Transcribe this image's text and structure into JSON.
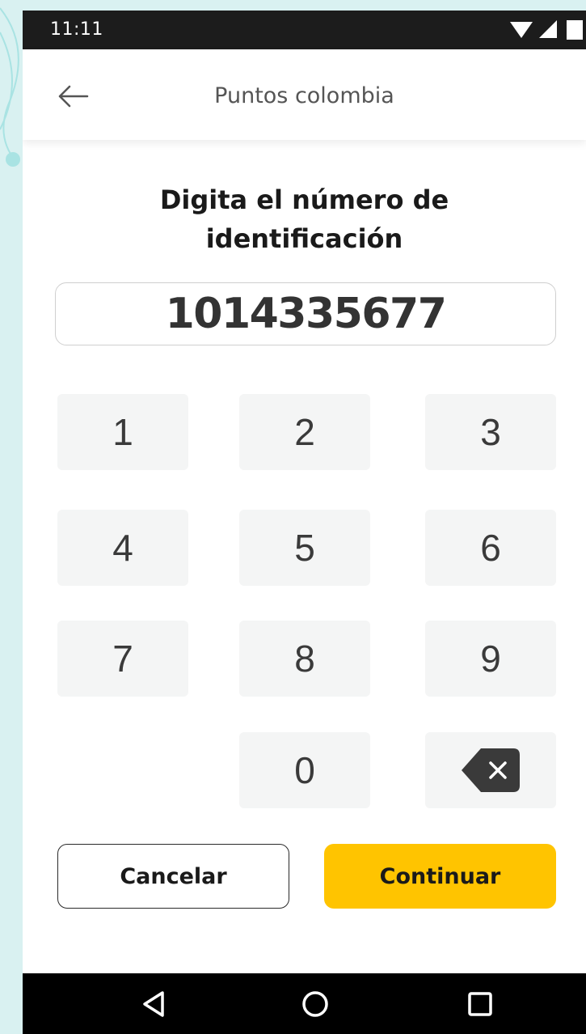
{
  "status_bar": {
    "time": "11:11"
  },
  "app_bar": {
    "title": "Puntos colombia"
  },
  "heading": {
    "line1": "Digita el número de",
    "line2": "identificación"
  },
  "id_input": {
    "value": "1014335677"
  },
  "keypad": {
    "keys": [
      "1",
      "2",
      "3",
      "4",
      "5",
      "6",
      "7",
      "8",
      "9",
      "0"
    ]
  },
  "actions": {
    "cancel_label": "Cancelar",
    "continue_label": "Continuar"
  },
  "colors": {
    "accent": "#ffc400",
    "background": "#ffffff",
    "key_bg": "#f4f5f5",
    "backdrop": "#d9f1f1"
  }
}
